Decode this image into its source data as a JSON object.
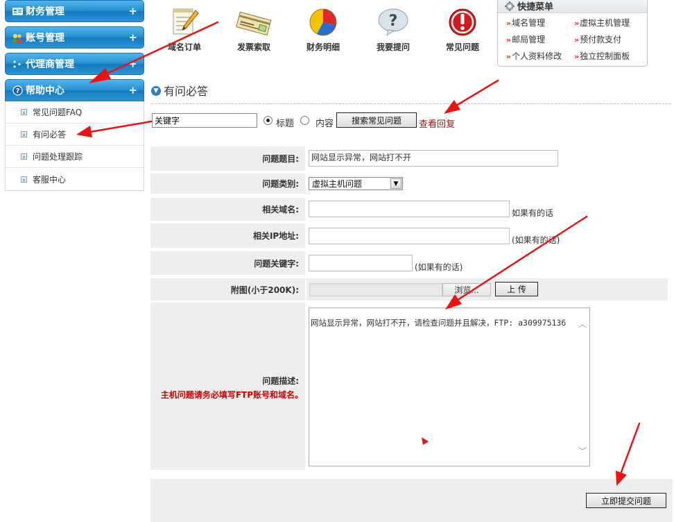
{
  "sidebar": {
    "categories": [
      {
        "label": "财务管理",
        "plus": "+"
      },
      {
        "label": "账号管理",
        "plus": "+"
      },
      {
        "label": "代理商管理",
        "plus": "+"
      },
      {
        "label": "帮助中心",
        "plus": "+"
      }
    ],
    "help_items": [
      {
        "label": "常见问题FAQ"
      },
      {
        "label": "有问必答"
      },
      {
        "label": "问题处理跟踪"
      },
      {
        "label": "客服中心"
      }
    ]
  },
  "toolbar": {
    "domain_order": "域名订单",
    "invoice": "发票索取",
    "finance": "财务明细",
    "ask": "我要提问",
    "faq": "常见问题"
  },
  "quick_menu": {
    "title": "快捷菜单",
    "links": [
      "域名管理",
      "虚拟主机管理",
      "邮局管理",
      "预付款支付",
      "个人资料修改",
      "独立控制面板"
    ]
  },
  "section": {
    "title": "有问必答"
  },
  "search": {
    "keyword_value": "关键字",
    "radio_title": "标题",
    "radio_content": "内容",
    "selected": "标题",
    "search_button": "搜索常见问题",
    "view_replies": "查看回复"
  },
  "form": {
    "subject_label": "问题题目:",
    "subject_value": "网站显示异常，网站打不开",
    "type_label": "问题类别:",
    "type_value": "虚拟主机问题",
    "domain_label": "相关域名:",
    "domain_hint": "如果有的话",
    "ip_label": "相关IP地址:",
    "ip_hint": "(如果有的话)",
    "keywords_label": "问题关键字:",
    "keywords_hint": "(如果有的话)",
    "attachment_label": "附图(小于200K):",
    "browse_button": "浏览...",
    "upload_button": "上 传",
    "description_label": "问题描述:",
    "description_note": "主机问题请务必填写FTP账号和域名。",
    "description_value": "网站显示异常，网站打不开，请检查问题并且解决，FTP: a309975136",
    "submit_button": "立即提交问题"
  },
  "colors": {
    "accent": "#2590d2",
    "annotation_arrow": "#ee1111",
    "required_text": "#d40000",
    "link": "#8a1a1a"
  }
}
